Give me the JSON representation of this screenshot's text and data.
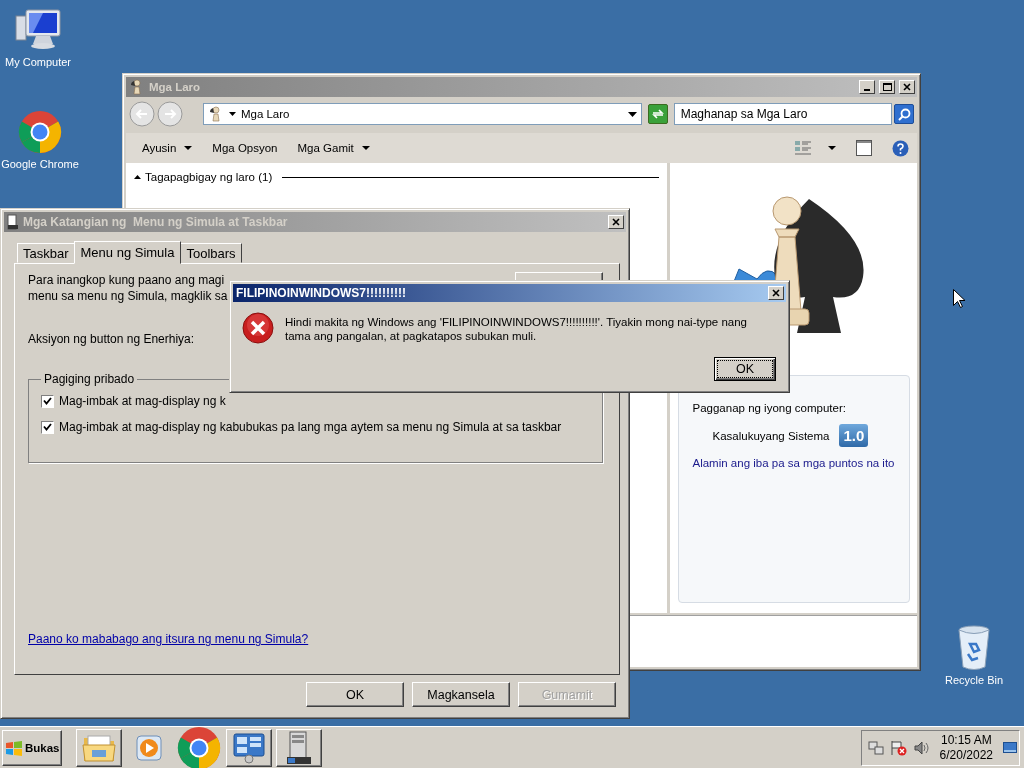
{
  "desktop_icons": [
    {
      "label": "My Computer",
      "kind": "computer"
    },
    {
      "label": "Google Chrome",
      "kind": "chrome"
    },
    {
      "label": "Recycle Bin",
      "kind": "recycle"
    }
  ],
  "games_window": {
    "title": "Mga Laro",
    "address": "Mga Laro",
    "search": {
      "placeholder": "Maghanap sa Mga Laro"
    },
    "toolbar": [
      {
        "label": "Ayusin",
        "has_menu": true
      },
      {
        "label": "Mga Opsyon",
        "has_menu": false
      },
      {
        "label": "Mga Gamit",
        "has_menu": true
      }
    ],
    "group_header": "Tagapagbigay ng laro (1)",
    "performance": {
      "text": "Pagganap ng iyong computer:",
      "system_label": "Kasalukuyang Sistema",
      "score": "1.0",
      "link": "Alamin ang iba pa sa mga puntos na ito"
    }
  },
  "properties_dialog": {
    "title": "Mga Katangian ng  Menu ng Simula at Taskbar",
    "tabs": [
      {
        "label": "Taskbar",
        "selected": false
      },
      {
        "label": "Menu ng Simula",
        "selected": true
      },
      {
        "label": "Toolbars",
        "selected": false
      }
    ],
    "intro_lines": [
      "Para inangkop kung paano ang magi",
      "menu sa menu ng Simula, magklik sa"
    ],
    "power_label": "Aksiyon ng button ng Enerhiya:",
    "privacy": {
      "title": "Pagiging pribado",
      "options": [
        {
          "label": "Mag-imbak at mag-display ng k",
          "checked": true
        },
        {
          "label": "Mag-imbak at mag-display ng kabubukas pa lang mga aytem sa menu ng Simula at sa taskbar",
          "checked": true
        }
      ]
    },
    "help_link": "Paano ko mababago ang itsura ng menu ng Simula?",
    "buttons": [
      {
        "label": "OK",
        "disabled": false
      },
      {
        "label": "Magkansela",
        "disabled": false
      },
      {
        "label": "Gumamit",
        "disabled": true
      }
    ]
  },
  "error_dialog": {
    "title": "FILIPINOINWINDOWS7!!!!!!!!!!",
    "message": "Hindi makita ng Windows ang 'FILIPINOINWINDOWS7!!!!!!!!!!'. Tiyakin mong nai-type nang tama ang pangalan, at pagkatapos subukan muli.",
    "button": "OK"
  },
  "taskbar": {
    "start_label": "Bukas",
    "apps": [
      {
        "kind": "explorer",
        "running": true
      },
      {
        "kind": "media",
        "running": false
      },
      {
        "kind": "chrome",
        "running": false
      },
      {
        "kind": "control",
        "running": true
      },
      {
        "kind": "server",
        "running": true
      }
    ],
    "clock": {
      "time": "10:15 AM",
      "date": "6/20/2022"
    }
  }
}
